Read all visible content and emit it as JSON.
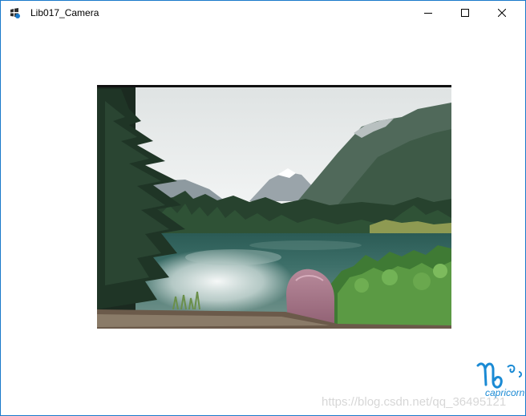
{
  "window": {
    "title": "Lib017_Camera",
    "controls": {
      "minimize_icon": "minimize-icon",
      "maximize_icon": "maximize-icon",
      "close_icon": "close-icon"
    },
    "accent_color": "#1979ca"
  },
  "camera_view": {
    "label": "camera-preview",
    "scene": "mountain-lake-landscape"
  },
  "watermark": {
    "text": "https://blog.csdn.net/qq_36495121"
  },
  "brand_logo": {
    "text": "capricorn",
    "icon": "capricorn-sign-icon",
    "color": "#1a8ad4"
  }
}
